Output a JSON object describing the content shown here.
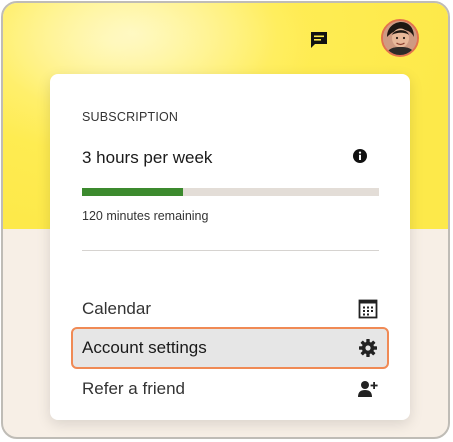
{
  "header": {
    "chat_icon": "chat-bubble-icon",
    "avatar": "user-avatar"
  },
  "menu": {
    "subscription_label": "SUBSCRIPTION",
    "plan_name": "3 hours per week",
    "usage_fraction": 0.34,
    "remaining_text": "120 minutes remaining",
    "items": [
      {
        "label": "Calendar",
        "icon": "calendar-icon"
      },
      {
        "label": "Account settings",
        "icon": "gear-icon",
        "active": true
      },
      {
        "label": "Refer a friend",
        "icon": "add-person-icon"
      }
    ]
  },
  "colors": {
    "hero_yellow": "#fde94a",
    "progress_fill": "#3c8a2e",
    "active_border": "#f08a55"
  }
}
